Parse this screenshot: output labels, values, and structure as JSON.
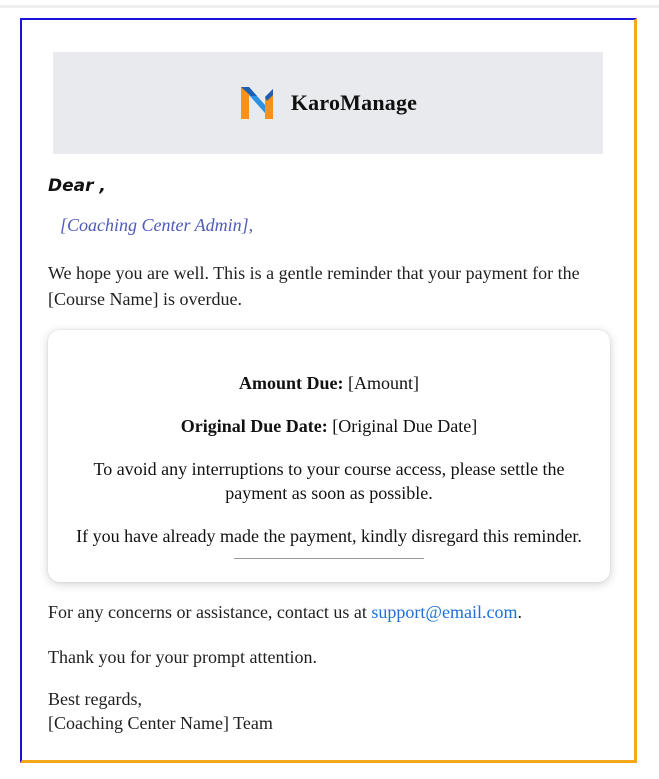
{
  "brand": {
    "name": "KaroManage",
    "logo_icon": "karomanage-logo-icon",
    "logo_colors": [
      "#f5921e",
      "#2f8fe0",
      "#1a5fb4"
    ]
  },
  "greeting": {
    "dear": "Dear ,",
    "recipient": "[Coaching Center Admin],"
  },
  "intro_text": "We hope you are well. This is a gentle reminder that your payment for the [Course Name] is overdue.",
  "card": {
    "amount_label": "Amount Due:",
    "amount_value": "[Amount]",
    "due_date_label": "Original Due Date:",
    "due_date_value": "[Original Due Date]",
    "interrupt_text": "To avoid any interruptions to your course access, please settle the payment as soon as possible.",
    "disregard_text": "If you have already made the payment, kindly disregard this reminder."
  },
  "contact": {
    "prefix": "For any concerns or assistance, contact us at",
    "email": "support@email.com",
    "suffix": "."
  },
  "thanks_text": "Thank you for your prompt attention.",
  "closing": {
    "regards": "Best regards,",
    "signature": "[Coaching Center Name] Team"
  },
  "colors": {
    "frame_left_top": "#1a12d6",
    "frame_right_bottom": "#f5a81b",
    "header_bg": "#e8eaee",
    "recipient": "#4d5bb8",
    "link": "#1f6fd6"
  }
}
